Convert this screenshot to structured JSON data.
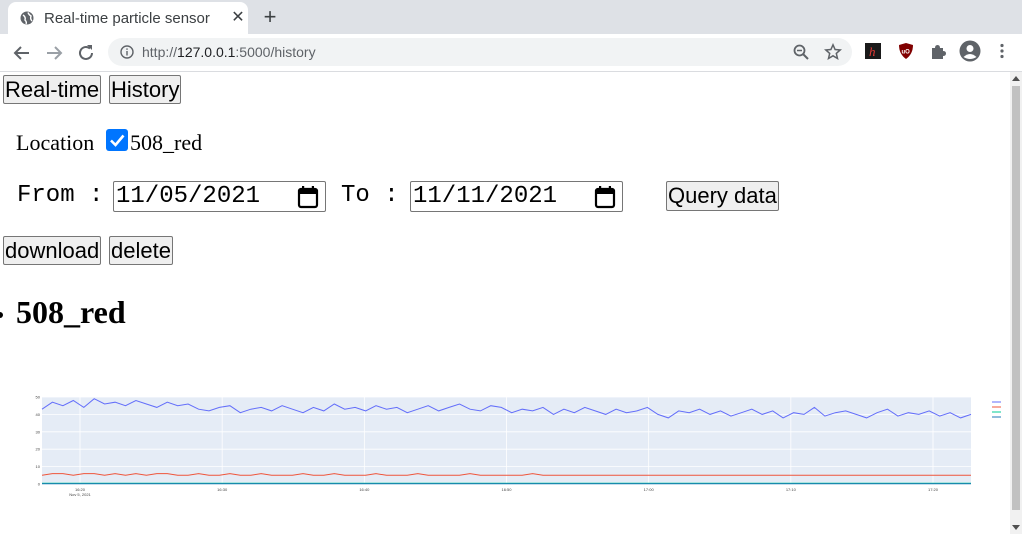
{
  "browser": {
    "tab_title": "Real-time particle sensor",
    "url_prefix": "http://",
    "url_host": "127.0.0.1",
    "url_path": ":5000/history"
  },
  "nav": {
    "realtime_label": "Real-time",
    "history_label": "History"
  },
  "filters": {
    "location_label": "Location",
    "location_option": "508_red",
    "location_checked": true,
    "from_label": "From :",
    "from_value": "11/05/2021",
    "to_label": "To :",
    "to_value": "11/11/2021",
    "query_label": "Query data"
  },
  "actions": {
    "download_label": "download",
    "delete_label": "delete"
  },
  "section": {
    "heading": "508_red"
  },
  "chart_data": {
    "type": "line",
    "ylim": [
      0,
      50
    ],
    "yticks": [
      0,
      10,
      20,
      30,
      40,
      50
    ],
    "ytick_labels": [
      "0",
      "10",
      "20",
      "30",
      "40",
      "50"
    ],
    "xtick_labels": [
      "16:20",
      "16:30",
      "16:40",
      "16:50",
      "17:00",
      "17:10",
      "17:20"
    ],
    "xtick_sublabel": "Nov 5, 2021",
    "grid": true,
    "legend_position": "right",
    "series": [
      {
        "color": "#636efa",
        "values": [
          43,
          47,
          45,
          48,
          44,
          49,
          46,
          47,
          45,
          48,
          46,
          44,
          47,
          45,
          46,
          43,
          42,
          44,
          45,
          41,
          43,
          44,
          42,
          45,
          43,
          41,
          44,
          42,
          46,
          43,
          44,
          42,
          45,
          43,
          44,
          41,
          43,
          45,
          42,
          44,
          46,
          43,
          42,
          45,
          44,
          41,
          43,
          42,
          44,
          40,
          43,
          41,
          44,
          42,
          40,
          43,
          41,
          42,
          44,
          40,
          38,
          42,
          41,
          43,
          40,
          42,
          39,
          41,
          43,
          40,
          42,
          38,
          41,
          40,
          44,
          39,
          41,
          42,
          40,
          38,
          41,
          43,
          39,
          41,
          40,
          42,
          39,
          41,
          38,
          40
        ]
      },
      {
        "color": "#ef553b",
        "values": [
          5,
          6,
          6,
          5,
          6,
          6,
          5,
          6,
          5,
          6,
          5,
          6,
          6,
          5,
          5,
          6,
          5,
          5,
          6,
          5,
          5,
          6,
          5,
          5,
          5,
          6,
          5,
          5,
          6,
          5,
          5,
          5,
          6,
          5,
          5,
          5,
          6,
          5,
          5,
          5,
          5,
          6,
          5,
          5,
          5,
          5,
          5,
          6,
          5,
          5,
          5,
          5,
          5,
          5,
          5,
          5,
          5,
          5,
          5,
          5,
          5,
          5,
          5,
          5,
          5,
          5,
          5,
          5,
          5,
          5,
          5,
          5,
          5,
          5,
          5,
          5,
          5,
          5,
          5,
          5,
          5,
          5,
          5,
          5,
          5,
          5,
          5,
          5,
          5,
          5
        ]
      },
      {
        "color": "#00cc96",
        "values": [
          0.4,
          0.4,
          0.4,
          0.4,
          0.4,
          0.4,
          0.4,
          0.4,
          0.4,
          0.4,
          0.4,
          0.4,
          0.4,
          0.4,
          0.4,
          0.4,
          0.4,
          0.4,
          0.4,
          0.4,
          0.4,
          0.4,
          0.4,
          0.4,
          0.4,
          0.4,
          0.4,
          0.4,
          0.4,
          0.4,
          0.4,
          0.4,
          0.4,
          0.4,
          0.4,
          0.4,
          0.4,
          0.4,
          0.4,
          0.4,
          0.4,
          0.4,
          0.4,
          0.4,
          0.4,
          0.4,
          0.4,
          0.4,
          0.4,
          0.4,
          0.4,
          0.4,
          0.4,
          0.4,
          0.4,
          0.4,
          0.4,
          0.4,
          0.4,
          0.4,
          0.4,
          0.4,
          0.4,
          0.4,
          0.4,
          0.4,
          0.4,
          0.4,
          0.4,
          0.4,
          0.4,
          0.4,
          0.4,
          0.4,
          0.4,
          0.4,
          0.4,
          0.4,
          0.4,
          0.4,
          0.4,
          0.4,
          0.4,
          0.4,
          0.4,
          0.4,
          0.4,
          0.4,
          0.4,
          0.4
        ]
      },
      {
        "color": "#1f77b4",
        "values": [
          0.2,
          0.2,
          0.2,
          0.2,
          0.2,
          0.2,
          0.2,
          0.2,
          0.2,
          0.2,
          0.2,
          0.2,
          0.2,
          0.2,
          0.2,
          0.2,
          0.2,
          0.2,
          0.2,
          0.2,
          0.2,
          0.2,
          0.2,
          0.2,
          0.2,
          0.2,
          0.2,
          0.2,
          0.2,
          0.2,
          0.2,
          0.2,
          0.2,
          0.2,
          0.2,
          0.2,
          0.2,
          0.2,
          0.2,
          0.2,
          0.2,
          0.2,
          0.2,
          0.2,
          0.2,
          0.2,
          0.2,
          0.2,
          0.2,
          0.2,
          0.2,
          0.2,
          0.2,
          0.2,
          0.2,
          0.2,
          0.2,
          0.2,
          0.2,
          0.2,
          0.2,
          0.2,
          0.2,
          0.2,
          0.2,
          0.2,
          0.2,
          0.2,
          0.2,
          0.2,
          0.2,
          0.2,
          0.2,
          0.2,
          0.2,
          0.2,
          0.2,
          0.2,
          0.2,
          0.2,
          0.2,
          0.2,
          0.2,
          0.2,
          0.2,
          0.2,
          0.2,
          0.2,
          0.2,
          0.2
        ]
      }
    ]
  }
}
